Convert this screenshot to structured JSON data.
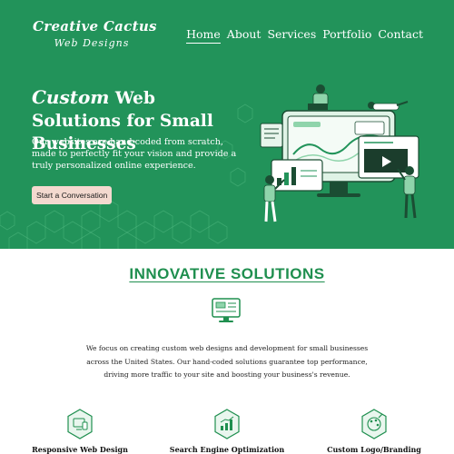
{
  "colors": {
    "brand_green": "#22935a",
    "title_green": "#1f8f4f",
    "cta_bg": "#f3d9cf",
    "white": "#ffffff"
  },
  "logo": {
    "line1": "Creative Cactus",
    "line2": "Web Designs",
    "icon": "cactus-icon"
  },
  "nav": {
    "items": [
      {
        "label": "Home",
        "active": true
      },
      {
        "label": "About",
        "active": false
      },
      {
        "label": "Services",
        "active": false
      },
      {
        "label": "Portfolio",
        "active": false
      },
      {
        "label": "Contact",
        "active": false
      }
    ]
  },
  "hero": {
    "headline_script": "Custom",
    "headline_rest": " Web Solutions for Small Businesses",
    "subcopy": "Our websites are hand-coded from scratch, made to perfectly fit your vision and provide a truly personalized online experience.",
    "cta_label": "Start a Conversation",
    "illustration": "people-building-website-illustration"
  },
  "solutions": {
    "title": "INNOVATIVE SOLUTIONS",
    "icon": "web-design-icon",
    "intro": "We focus on creating custom web designs and development for small businesses across the United States. Our hand-coded solutions guarantee top performance, driving more traffic to your site and boosting your business's revenue.",
    "features": [
      {
        "label": "Responsive Web Design",
        "icon": "responsive-devices-icon"
      },
      {
        "label": "Search Engine Optimization",
        "icon": "seo-growth-icon"
      },
      {
        "label": "Custom Logo/Branding",
        "icon": "branding-palette-icon"
      }
    ]
  }
}
